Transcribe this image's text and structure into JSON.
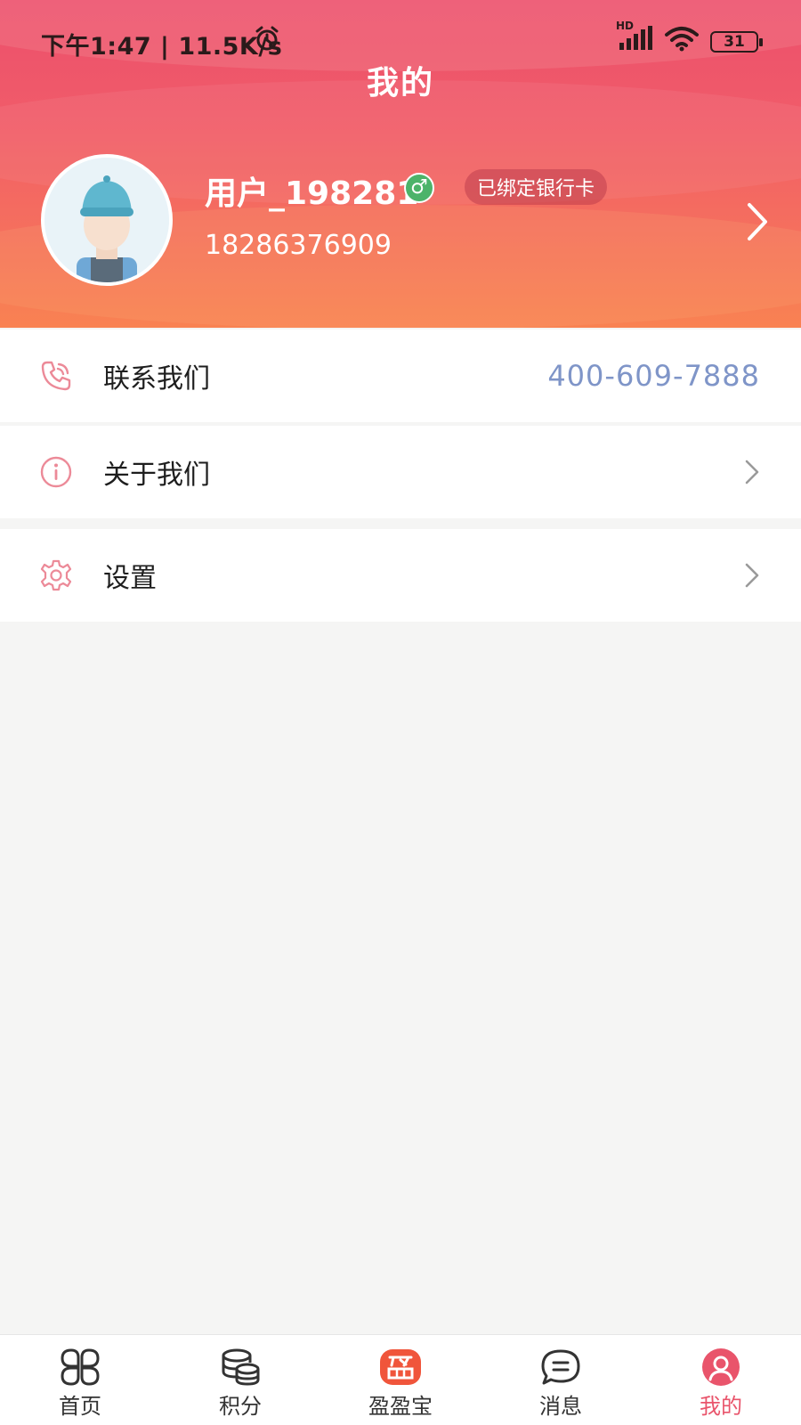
{
  "status_bar": {
    "time": "下午1:47 | 11.5K/s",
    "battery": "31",
    "network_label": "HD"
  },
  "header": {
    "title": "我的"
  },
  "profile": {
    "username": "用户_198281",
    "gender_symbol": "♂",
    "badge": "已绑定银行卡",
    "phone": "18286376909"
  },
  "menu": {
    "contact_label": "联系我们",
    "contact_phone": "400-609-7888",
    "about_label": "关于我们",
    "settings_label": "设置"
  },
  "bottom_nav": {
    "items": [
      {
        "label": "首页",
        "icon": "grid-four-icon"
      },
      {
        "label": "积分",
        "icon": "coins-icon"
      },
      {
        "label": "盈盈宝",
        "icon": "yingyingbao-icon"
      },
      {
        "label": "消息",
        "icon": "chat-icon"
      },
      {
        "label": "我的",
        "icon": "user-icon"
      }
    ],
    "active_index": 4
  },
  "colors": {
    "accent": "#e9546b",
    "phone_link": "#7f95c8",
    "gender_green": "#4cb36a"
  }
}
